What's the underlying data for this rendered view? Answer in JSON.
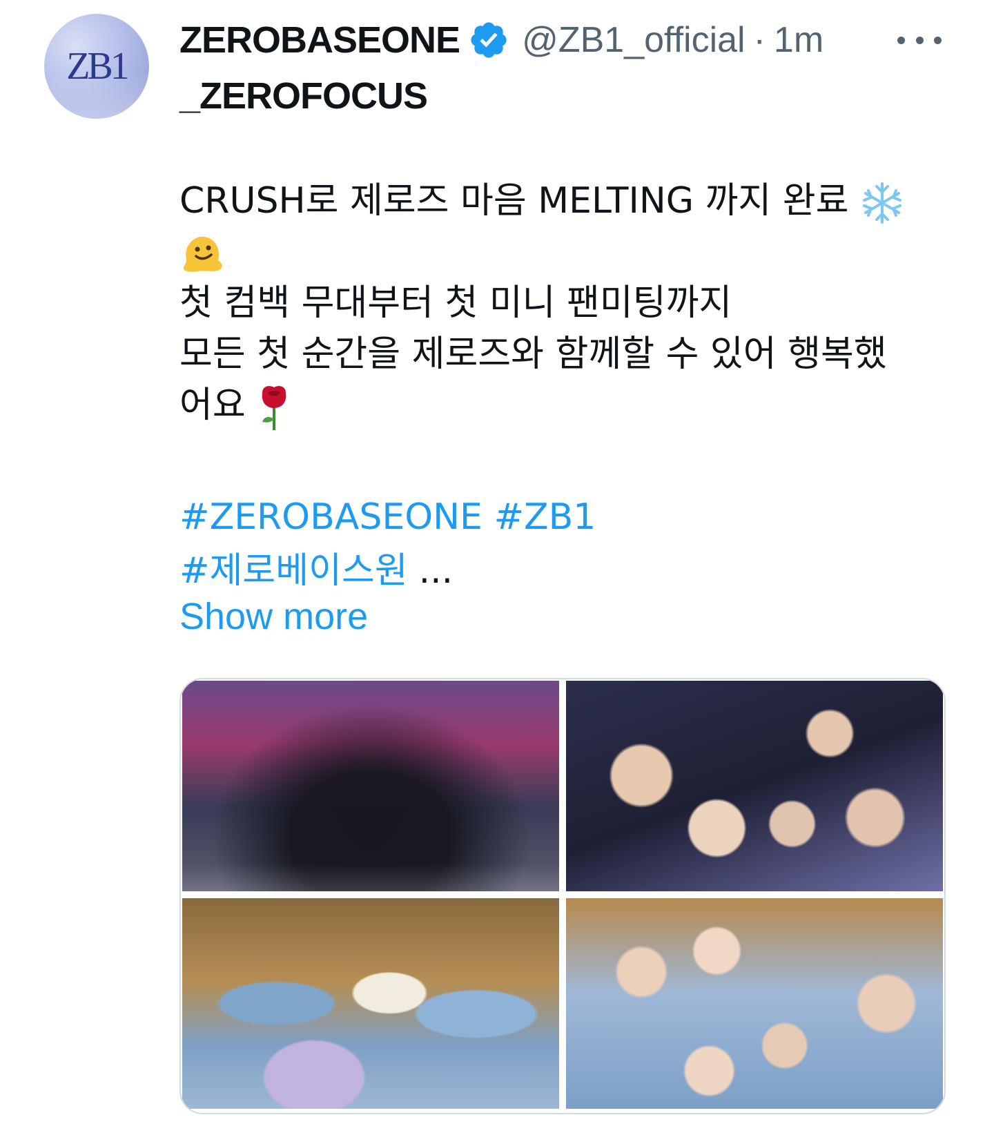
{
  "author": {
    "display_name": "ZEROBASEONE",
    "subname": "_ZEROFOCUS",
    "handle": "@ZB1_official",
    "separator": "·",
    "time": "1m",
    "avatar_text": "ZB1",
    "verified": true
  },
  "body": {
    "line1": "CRUSH로 제로즈 마음 MELTING 까지 완료",
    "line2": "첫 컴백 무대부터 첫 미니 팬미팅까지",
    "line3": "모든 첫 순간을 제로즈와 함께할 수 있어 행복했",
    "line4": "어요",
    "emojis": [
      "snowflake-emoji",
      "melting-face-emoji",
      "rose-emoji"
    ]
  },
  "hashtags": {
    "tag1": "#ZEROBASEONE",
    "tag2": "#ZB1",
    "tag3": "#제로베이스원",
    "ellipsis": "..."
  },
  "show_more": "Show more",
  "colors": {
    "link": "#1d9bf0",
    "verified": "#1d9bf0",
    "secondary_text": "#536471",
    "border": "#cfd9de"
  },
  "media": {
    "count": 4
  }
}
